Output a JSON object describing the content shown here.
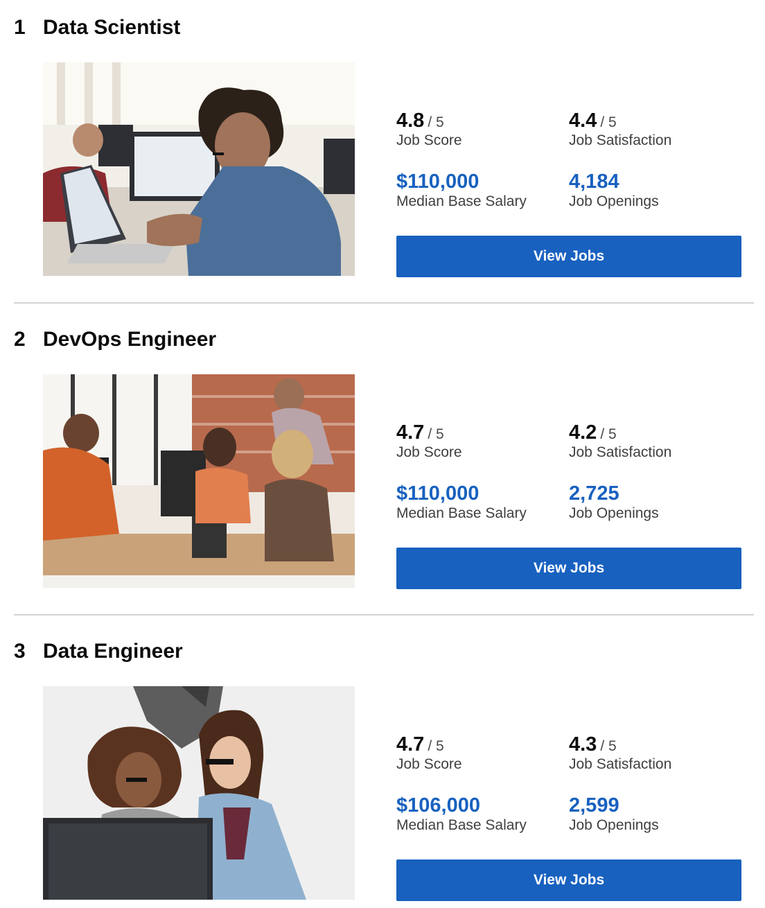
{
  "jobs": [
    {
      "rank": "1",
      "title": "Data Scientist",
      "job_score": "4.8",
      "job_score_out_of": "/ 5",
      "job_score_label": "Job Score",
      "job_satisfaction": "4.4",
      "job_satisfaction_out_of": "/ 5",
      "job_satisfaction_label": "Job Satisfaction",
      "median_base_salary": "$110,000",
      "median_base_salary_label": "Median Base Salary",
      "job_openings": "4,184",
      "job_openings_label": "Job Openings",
      "button_label": "View Jobs"
    },
    {
      "rank": "2",
      "title": "DevOps Engineer",
      "job_score": "4.7",
      "job_score_out_of": "/ 5",
      "job_score_label": "Job Score",
      "job_satisfaction": "4.2",
      "job_satisfaction_out_of": "/ 5",
      "job_satisfaction_label": "Job Satisfaction",
      "median_base_salary": "$110,000",
      "median_base_salary_label": "Median Base Salary",
      "job_openings": "2,725",
      "job_openings_label": "Job Openings",
      "button_label": "View Jobs"
    },
    {
      "rank": "3",
      "title": "Data Engineer",
      "job_score": "4.7",
      "job_score_out_of": "/ 5",
      "job_score_label": "Job Score",
      "job_satisfaction": "4.3",
      "job_satisfaction_out_of": "/ 5",
      "job_satisfaction_label": "Job Satisfaction",
      "median_base_salary": "$106,000",
      "median_base_salary_label": "Median Base Salary",
      "job_openings": "2,599",
      "job_openings_label": "Job Openings",
      "button_label": "View Jobs"
    }
  ],
  "colors": {
    "accent_blue": "#1861bf",
    "divider": "#d3d3d3",
    "text_dark": "#0c0c0c",
    "text_muted": "#3f3f3f"
  }
}
